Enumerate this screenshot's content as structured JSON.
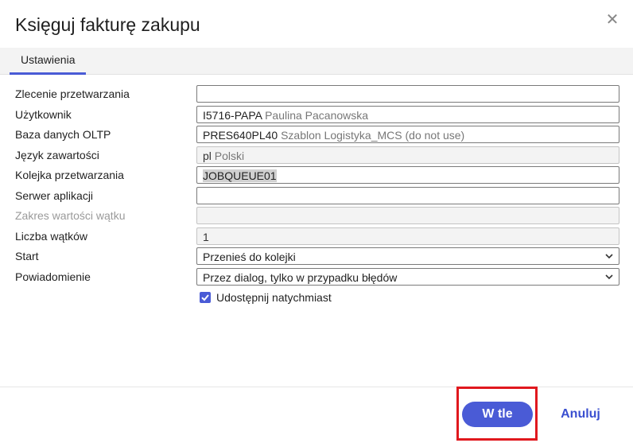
{
  "dialog": {
    "title": "Księguj fakturę zakupu",
    "close_icon": "close-icon"
  },
  "tabs": [
    {
      "label": "Ustawienia",
      "active": true
    }
  ],
  "form": {
    "rows": [
      {
        "label": "Zlecenie przetwarzania",
        "code": "",
        "desc": "",
        "type": "text",
        "readonly": false
      },
      {
        "label": "Użytkownik",
        "code": "I5716-PAPA",
        "desc": "Paulina Pacanowska",
        "type": "text",
        "readonly": false
      },
      {
        "label": "Baza danych OLTP",
        "code": "PRES640PL40",
        "desc": "Szablon Logistyka_MCS (do not use)",
        "type": "text",
        "readonly": false
      },
      {
        "label": "Język zawartości",
        "code": "pl",
        "desc": "Polski",
        "type": "text",
        "readonly": true
      },
      {
        "label": "Kolejka przetwarzania",
        "code": "JOBQUEUE01",
        "desc": "",
        "type": "text",
        "readonly": false
      },
      {
        "label": "Serwer aplikacji",
        "code": "",
        "desc": "",
        "type": "text",
        "readonly": false
      },
      {
        "label": "Zakres wartości wątku",
        "code": "",
        "desc": "",
        "type": "text",
        "readonly": true,
        "disabled_label": true
      },
      {
        "label": "Liczba wątków",
        "code": "1",
        "desc": "",
        "type": "text",
        "readonly": true
      },
      {
        "label": "Start",
        "code": "Przenieś do kolejki",
        "desc": "",
        "type": "select",
        "readonly": false
      },
      {
        "label": "Powiadomienie",
        "code": "Przez dialog, tylko w przypadku błędów",
        "desc": "",
        "type": "select",
        "readonly": false
      }
    ],
    "checkbox": {
      "label": "Udostępnij natychmiast",
      "checked": true
    }
  },
  "footer": {
    "primary_label": "W tle",
    "cancel_label": "Anuluj"
  },
  "colors": {
    "accent": "#4a5bd6",
    "highlight": "#e0181e"
  }
}
